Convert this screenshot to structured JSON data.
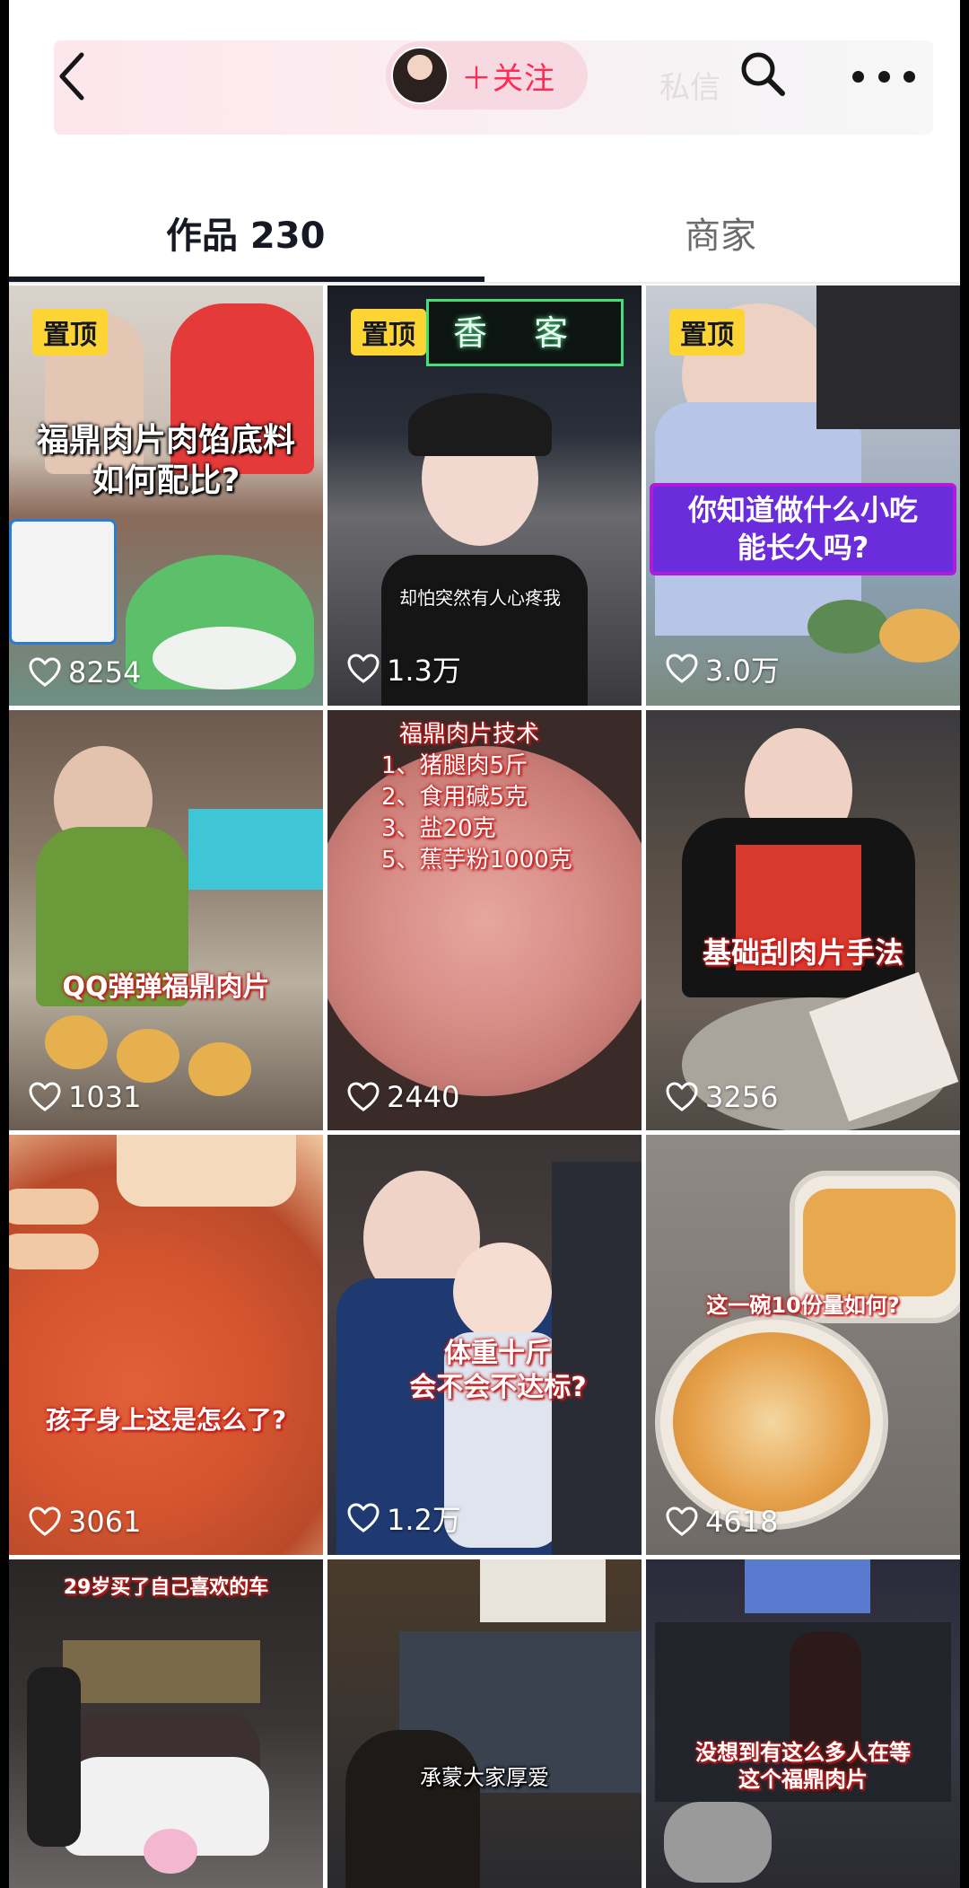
{
  "header": {
    "follow_label": "＋关注",
    "ghost_label": "私信",
    "icons": [
      "chevron-left-icon",
      "search-icon",
      "more-icon"
    ]
  },
  "tabs": [
    {
      "label": "作品 230",
      "active": true
    },
    {
      "label": "商家",
      "active": false
    }
  ],
  "colors": {
    "accent": "#fe2c55",
    "pin": "#fcd535",
    "text": "#161823"
  },
  "videos": [
    {
      "pinned": true,
      "pin_label": "置顶",
      "caption": [
        "福鼎肉片肉馅底料",
        "如何配比?"
      ],
      "likes": "8254"
    },
    {
      "pinned": true,
      "pin_label": "置顶",
      "sign": "香 客",
      "caption_small": "却怕突然有人心疼我",
      "likes": "1.3万"
    },
    {
      "pinned": true,
      "pin_label": "置顶",
      "caption": [
        "你知道做什么小吃",
        "能长久吗?"
      ],
      "likes": "3.0万"
    },
    {
      "pinned": false,
      "caption": [
        "QQ弹弹福鼎肉片"
      ],
      "likes": "1031"
    },
    {
      "pinned": false,
      "caption": [
        "福鼎肉片技术",
        "1、猪腿肉5斤",
        "2、食用碱5克",
        "3、盐20克",
        "5、蕉芋粉1000克"
      ],
      "likes": "2440"
    },
    {
      "pinned": false,
      "caption": [
        "基础刮肉片手法"
      ],
      "likes": "3256"
    },
    {
      "pinned": false,
      "caption": [
        "孩子身上这是怎么了?"
      ],
      "likes": "3061"
    },
    {
      "pinned": false,
      "caption": [
        "体重十斤",
        "会不会不达标?"
      ],
      "likes": "1.2万"
    },
    {
      "pinned": false,
      "caption": [
        "这一碗10份量如何?"
      ],
      "likes": "4618"
    },
    {
      "pinned": false,
      "caption": [
        "29岁买了自己喜欢的车"
      ],
      "likes": ""
    },
    {
      "pinned": false,
      "caption": [
        "承蒙大家厚爱"
      ],
      "likes": ""
    },
    {
      "pinned": false,
      "caption": [
        "没想到有这么多人在等",
        "这个福鼎肉片"
      ],
      "likes": ""
    }
  ]
}
